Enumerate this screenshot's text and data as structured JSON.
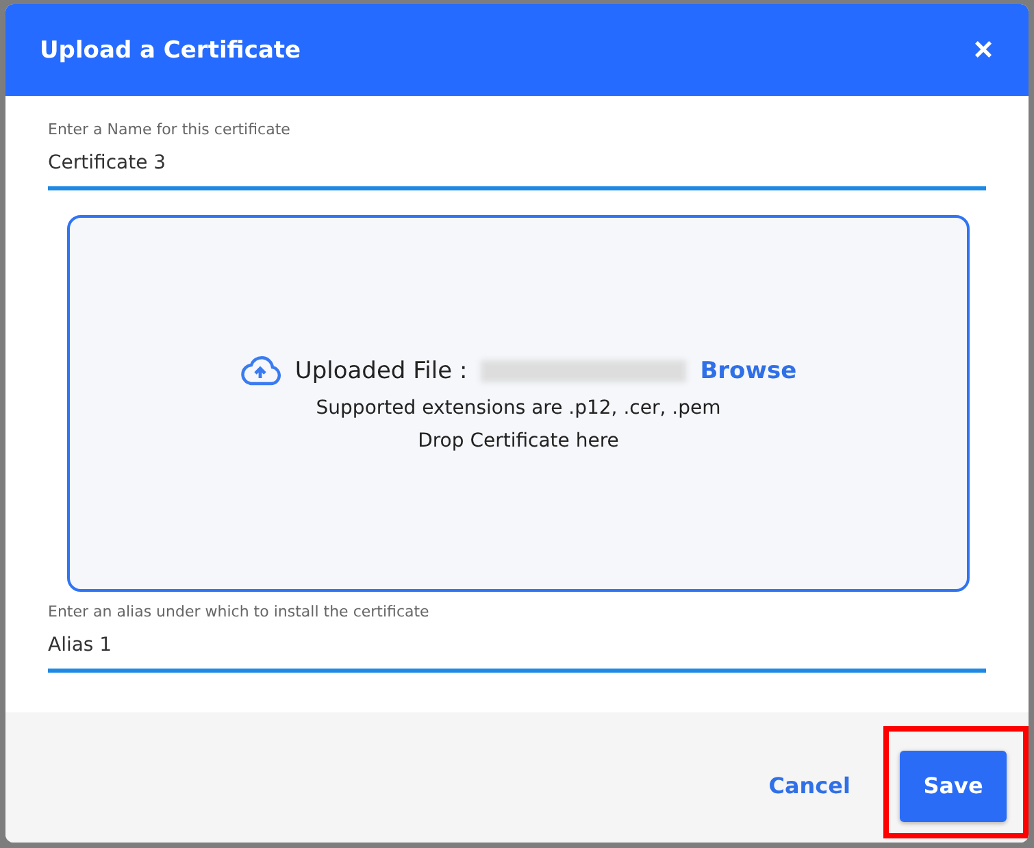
{
  "dialog": {
    "title": "Upload a Certificate",
    "close": "×"
  },
  "name_field": {
    "label": "Enter a Name for this certificate",
    "value": "Certificate 3"
  },
  "drop_zone": {
    "uploaded_label": "Uploaded File :",
    "browse": "Browse",
    "extensions": "Supported extensions are .p12, .cer, .pem",
    "hint": "Drop Certificate here"
  },
  "alias_field": {
    "label": "Enter an alias under which to install the certificate",
    "value": "Alias 1"
  },
  "buttons": [
    {
      "label": "Cancel",
      "kind": "link",
      "highlighted": false
    },
    {
      "label": "Save",
      "kind": "primary",
      "highlighted": true
    }
  ]
}
